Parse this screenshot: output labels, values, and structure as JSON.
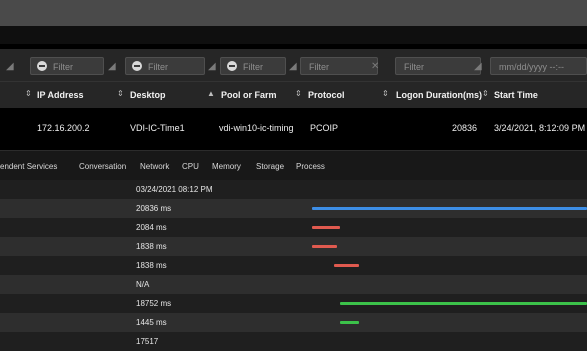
{
  "filters": [
    {
      "icon": "filter-icon",
      "placeholder": "Filter",
      "has_icon": true
    },
    {
      "icon": "filter-icon",
      "placeholder": "Filter",
      "has_icon": true
    },
    {
      "icon": "filter-icon",
      "placeholder": "Filter",
      "has_icon": true
    },
    {
      "icon": "",
      "placeholder": "Filter",
      "has_icon": false
    },
    {
      "icon": "",
      "placeholder": "Filter",
      "has_icon": false
    },
    {
      "icon": "",
      "placeholder": "mm/dd/yyyy --:--",
      "has_icon": false
    }
  ],
  "columns": [
    {
      "label": "IP Address",
      "sort_icon": "sort-icon"
    },
    {
      "label": "Desktop",
      "sort_icon": "sort-icon"
    },
    {
      "label": "Pool or Farm",
      "sort_icon": "sort-ascending-icon"
    },
    {
      "label": "Protocol",
      "sort_icon": "sort-icon"
    },
    {
      "label": "Logon Duration(ms)",
      "sort_icon": "sort-icon"
    },
    {
      "label": "Start Time",
      "sort_icon": ""
    }
  ],
  "row": {
    "ip": "172.16.200.2",
    "desktop": "VDI-IC-Time1",
    "pool": "vdi-win10-ic-timing",
    "protocol": "PCOIP",
    "duration": "20836",
    "start_time": "3/24/2021, 8:12:09 PM"
  },
  "tabs": [
    "endent Services",
    "Conversation",
    "Network",
    "CPU",
    "Memory",
    "Storage",
    "Process"
  ],
  "timeline": {
    "header": "03/24/2021 08:12 PM",
    "items": [
      {
        "label": "20836 ms",
        "color": "#3d8ee6",
        "start": 0.0,
        "length": 1.0
      },
      {
        "label": "2084 ms",
        "color": "#e05a4f",
        "start": 0.0,
        "length": 0.1
      },
      {
        "label": "1838 ms",
        "color": "#e05a4f",
        "start": 0.0,
        "length": 0.09
      },
      {
        "label": "1838 ms",
        "color": "#e05a4f",
        "start": 0.08,
        "length": 0.09
      },
      {
        "label": "N/A",
        "color": "",
        "start": 0,
        "length": 0
      },
      {
        "label": "18752 ms",
        "color": "#3cc24a",
        "start": 0.1,
        "length": 0.9
      },
      {
        "label": "1445 ms",
        "color": "#3cc24a",
        "start": 0.1,
        "length": 0.07
      },
      {
        "label": "17517",
        "color": "",
        "start": 0,
        "length": 0
      }
    ]
  },
  "colors": {
    "blue": "#3d8ee6",
    "red": "#e05a4f",
    "green": "#3cc24a"
  }
}
